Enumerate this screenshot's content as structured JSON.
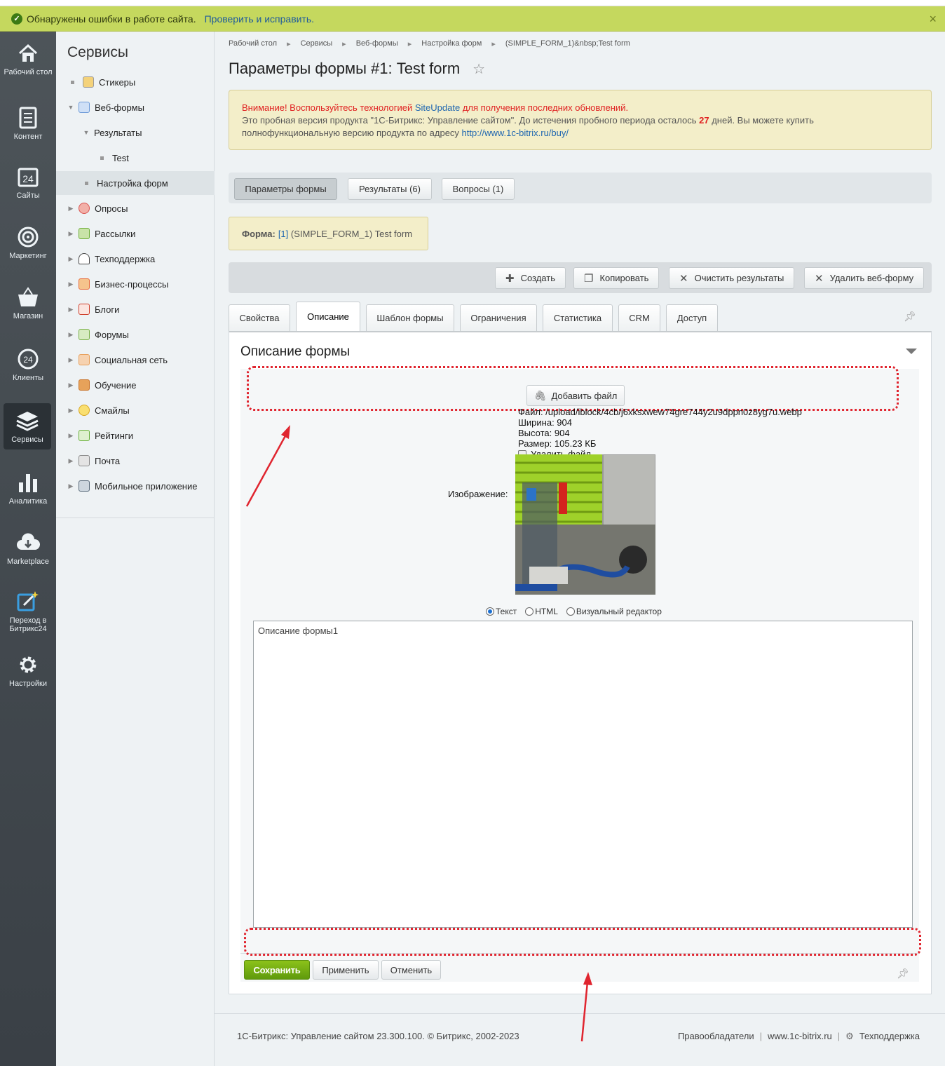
{
  "error_bar": {
    "message": "Обнаружены ошибки в работе сайта.",
    "link": "Проверить и исправить.",
    "close": "×"
  },
  "leftnav": [
    {
      "label": "Рабочий стол",
      "icon": "home-icon"
    },
    {
      "label": "Контент",
      "icon": "document-icon"
    },
    {
      "label": "Сайты",
      "icon": "calendar-24-icon"
    },
    {
      "label": "Маркетинг",
      "icon": "target-icon"
    },
    {
      "label": "Магазин",
      "icon": "basket-icon"
    },
    {
      "label": "Клиенты",
      "icon": "clients-24-icon"
    },
    {
      "label": "Сервисы",
      "icon": "layers-icon"
    },
    {
      "label": "Аналитика",
      "icon": "bar-chart-icon"
    },
    {
      "label": "Marketplace",
      "icon": "cloud-download-icon"
    },
    {
      "label": "Переход в Битрикс24",
      "icon": "edit-sparkle-icon"
    },
    {
      "label": "Настройки",
      "icon": "gear-icon"
    }
  ],
  "menu": {
    "title": "Сервисы",
    "items": [
      {
        "label": "Стикеры",
        "arrow": "",
        "icon_color": "#e8b33c"
      },
      {
        "label": "Веб-формы",
        "arrow": "▼",
        "icon_color": "#6e9bd8"
      },
      {
        "label": "Результаты",
        "arrow": "▼",
        "icon_color": ""
      },
      {
        "label": "Test",
        "arrow": "",
        "icon_color": ""
      },
      {
        "label": "Настройка форм",
        "arrow": "",
        "icon_color": ""
      },
      {
        "label": "Опросы",
        "arrow": "▶",
        "icon_color": "#d9534f"
      },
      {
        "label": "Рассылки",
        "arrow": "▶",
        "icon_color": "#6fae3a"
      },
      {
        "label": "Техподдержка",
        "arrow": "▶",
        "icon_color": "#4a4a4a"
      },
      {
        "label": "Бизнес-процессы",
        "arrow": "▶",
        "icon_color": "#e86c3c"
      },
      {
        "label": "Блоги",
        "arrow": "▶",
        "icon_color": "#d0402c"
      },
      {
        "label": "Форумы",
        "arrow": "▶",
        "icon_color": "#7ab04a"
      },
      {
        "label": "Социальная сеть",
        "arrow": "▶",
        "icon_color": "#e8a05c"
      },
      {
        "label": "Обучение",
        "arrow": "▶",
        "icon_color": "#c9742a"
      },
      {
        "label": "Смайлы",
        "arrow": "▶",
        "icon_color": "#f2c230"
      },
      {
        "label": "Рейтинги",
        "arrow": "▶",
        "icon_color": "#6ab03c"
      },
      {
        "label": "Почта",
        "arrow": "▶",
        "icon_color": "#8a8a8a"
      },
      {
        "label": "Мобильное приложение",
        "arrow": "▶",
        "icon_color": "#5a6a7a"
      }
    ]
  },
  "breadcrumbs": [
    "Рабочий стол",
    "Сервисы",
    "Веб-формы",
    "Настройка форм",
    "(SIMPLE_FORM_1)&nbsp;Test form"
  ],
  "page_title": "Параметры формы #1: Test form",
  "warning": {
    "line1_prefix": "Внимание! Воспользуйтесь технологией ",
    "line1_link": "SiteUpdate",
    "line1_suffix": " для получения последних обновлений.",
    "line2_prefix": "Это пробная версия продукта \"1С-Битрикс: Управление сайтом\". До истечения пробного периода осталось ",
    "days": "27",
    "line2_suffix": " дней. Вы можете купить",
    "line3_prefix": "полнофункциональную версию продукта по адресу ",
    "line3_link": "http://www.1c-bitrix.ru/buy/"
  },
  "form_tabs": [
    "Параметры формы",
    "Результаты (6)",
    "Вопросы (1)"
  ],
  "form_box": {
    "label": "Форма:",
    "id_link": "[1]",
    "text": "(SIMPLE_FORM_1) Test form"
  },
  "toolbar": {
    "create": "Создать",
    "copy": "Копировать",
    "clear": "Очистить результаты",
    "delete": "Удалить веб-форму"
  },
  "tabs": [
    "Свойства",
    "Описание",
    "Шаблон формы",
    "Ограничения",
    "Статистика",
    "CRM",
    "Доступ"
  ],
  "active_tab": "Описание",
  "section_title": "Описание формы",
  "file": {
    "add_button": "Добавить файл",
    "path": "Файл: /upload/iblock/4cb/j6xksxwew74gre744y2u9dppn0z8yg7u.webp",
    "width": "Ширина: 904",
    "height": "Высота: 904",
    "size": "Размер: 105.23 КБ",
    "delete_label": "Удалить файл",
    "image_label": "Изображение:"
  },
  "editor_modes": {
    "text": "Текст",
    "html": "HTML",
    "visual": "Визуальный редактор",
    "selected": "Текст"
  },
  "textarea_value": "Описание формы1",
  "buttons": {
    "save": "Сохранить",
    "apply": "Применить",
    "cancel": "Отменить"
  },
  "footer": {
    "copyright": "1С-Битрикс: Управление сайтом 23.300.100. © Битрикс, 2002-2023",
    "rights": "Правообладатели",
    "site": "www.1c-bitrix.ru",
    "support": "Техподдержка"
  },
  "colors": {
    "error_bar": "#c5d85e",
    "save_button": "#7ab317",
    "annotation": "#e0252f",
    "warning_bg": "#f3eec9"
  }
}
